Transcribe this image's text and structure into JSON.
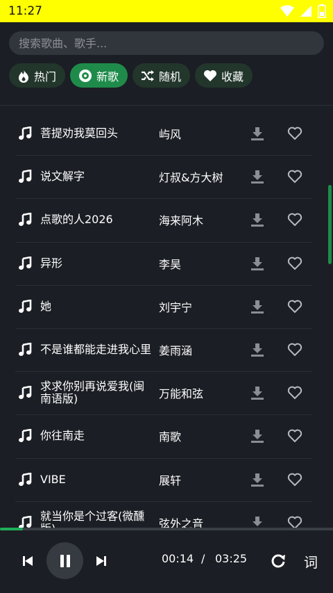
{
  "status_bar": {
    "time": "11:27",
    "background": "#ffff00",
    "icons": [
      "wifi-icon",
      "signal-icon",
      "battery-icon"
    ]
  },
  "search": {
    "placeholder": "搜索歌曲、歌手..."
  },
  "tabs": [
    {
      "label": "热门",
      "icon": "fire-icon",
      "active": false
    },
    {
      "label": "新歌",
      "icon": "disc-icon",
      "active": true
    },
    {
      "label": "随机",
      "icon": "shuffle-icon",
      "active": false
    },
    {
      "label": "收藏",
      "icon": "heart-icon",
      "active": false
    }
  ],
  "songs": [
    {
      "title": "菩提劝我莫回头",
      "artist": "屿风"
    },
    {
      "title": "说文解字",
      "artist": "灯叔&方大树"
    },
    {
      "title": "点歌的人2026",
      "artist": "海来阿木"
    },
    {
      "title": "异形",
      "artist": "李昊"
    },
    {
      "title": "她",
      "artist": "刘宇宁"
    },
    {
      "title": "不是谁都能走进我心里",
      "artist": "姜雨涵"
    },
    {
      "title": "求求你别再说爱我(闽南语版)",
      "artist": "万能和弦"
    },
    {
      "title": "你往南走",
      "artist": "南歌"
    },
    {
      "title": "VIBE",
      "artist": "展轩"
    },
    {
      "title": "就当你是个过客(微醺版)",
      "artist": "弦外之音"
    }
  ],
  "player": {
    "current_time": "00:14",
    "separator": "/",
    "total_time": "03:25",
    "progress": 0.068,
    "lyrics_label": "词"
  },
  "colors": {
    "accent": "#1f8b4a",
    "background": "#1b1e24",
    "tab_bg": "#22362b"
  }
}
